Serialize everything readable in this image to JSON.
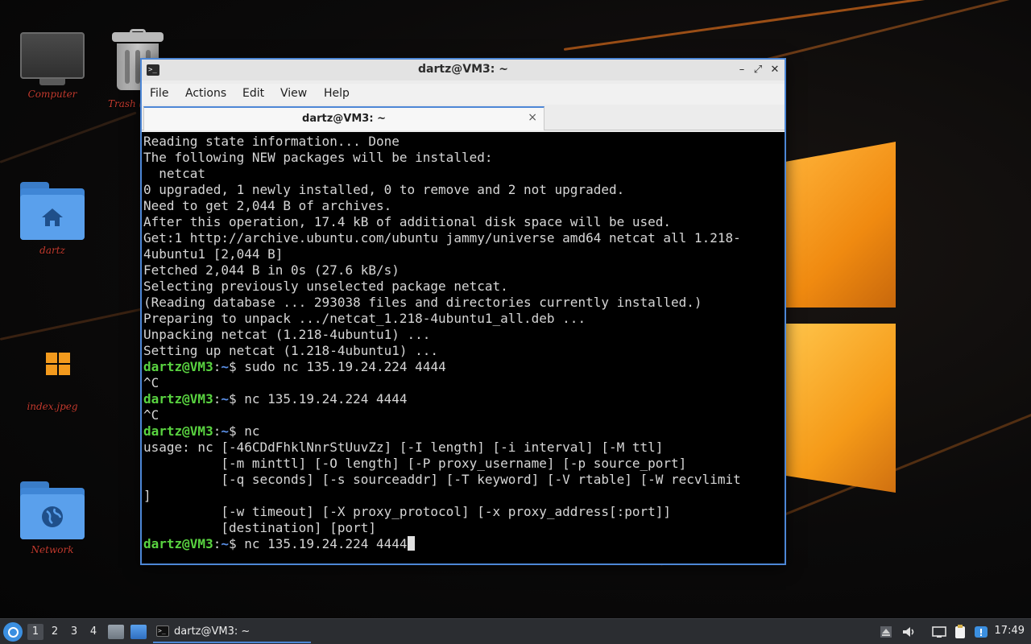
{
  "desktop": {
    "icons": [
      {
        "label": "Computer",
        "icon": "computer-icon"
      },
      {
        "label": "Trash (",
        "icon": "trash-icon"
      },
      {
        "label": "dartz",
        "icon": "home-folder-icon"
      },
      {
        "label": "index.jpeg",
        "icon": "image-file-icon"
      },
      {
        "label": "Network",
        "icon": "network-folder-icon"
      }
    ]
  },
  "window": {
    "title": "dartz@VM3: ~",
    "menu": [
      "File",
      "Actions",
      "Edit",
      "View",
      "Help"
    ],
    "tab_title": "dartz@VM3: ~",
    "tab_close": "×",
    "buttons": {
      "minimize": "–",
      "maximize": "⤢",
      "close": "✕"
    }
  },
  "terminal": {
    "prompt_user": "dartz@VM3",
    "prompt_colon": ":",
    "prompt_dir": "~",
    "prompt_sign": "$",
    "lines": [
      {
        "type": "out",
        "text": "Reading state information... Done"
      },
      {
        "type": "out",
        "text": "The following NEW packages will be installed:"
      },
      {
        "type": "out",
        "text": "  netcat"
      },
      {
        "type": "out",
        "text": "0 upgraded, 1 newly installed, 0 to remove and 2 not upgraded."
      },
      {
        "type": "out",
        "text": "Need to get 2,044 B of archives."
      },
      {
        "type": "out",
        "text": "After this operation, 17.4 kB of additional disk space will be used."
      },
      {
        "type": "out",
        "text": "Get:1 http://archive.ubuntu.com/ubuntu jammy/universe amd64 netcat all 1.218-"
      },
      {
        "type": "out",
        "text": "4ubuntu1 [2,044 B]"
      },
      {
        "type": "out",
        "text": "Fetched 2,044 B in 0s (27.6 kB/s)"
      },
      {
        "type": "out",
        "text": "Selecting previously unselected package netcat."
      },
      {
        "type": "out",
        "text": "(Reading database ... 293038 files and directories currently installed.)"
      },
      {
        "type": "out",
        "text": "Preparing to unpack .../netcat_1.218-4ubuntu1_all.deb ..."
      },
      {
        "type": "out",
        "text": "Unpacking netcat (1.218-4ubuntu1) ..."
      },
      {
        "type": "out",
        "text": "Setting up netcat (1.218-4ubuntu1) ..."
      },
      {
        "type": "cmd",
        "text": " sudo nc 135.19.24.224 4444"
      },
      {
        "type": "out",
        "text": "^C"
      },
      {
        "type": "cmd",
        "text": " nc 135.19.24.224 4444"
      },
      {
        "type": "out",
        "text": "^C"
      },
      {
        "type": "cmd",
        "text": " nc"
      },
      {
        "type": "out",
        "text": "usage: nc [-46CDdFhklNnrStUuvZz] [-I length] [-i interval] [-M ttl]"
      },
      {
        "type": "out",
        "text": "          [-m minttl] [-O length] [-P proxy_username] [-p source_port]"
      },
      {
        "type": "out",
        "text": "          [-q seconds] [-s sourceaddr] [-T keyword] [-V rtable] [-W recvlimit"
      },
      {
        "type": "out",
        "text": "]"
      },
      {
        "type": "out",
        "text": "          [-w timeout] [-X proxy_protocol] [-x proxy_address[:port]]"
      },
      {
        "type": "out",
        "text": "          [destination] [port]"
      },
      {
        "type": "input",
        "text": " nc 135.19.24.224 4444"
      }
    ]
  },
  "taskbar": {
    "workspaces": [
      "1",
      "2",
      "3",
      "4"
    ],
    "active_workspace": "1",
    "task_label": "dartz@VM3: ~",
    "clock": "17:49"
  },
  "colors": {
    "accent": "#4d87d6",
    "prompt_user": "#59d340",
    "prompt_dir": "#5a8fe6",
    "wallpaper_orange": "#f39a1d"
  }
}
